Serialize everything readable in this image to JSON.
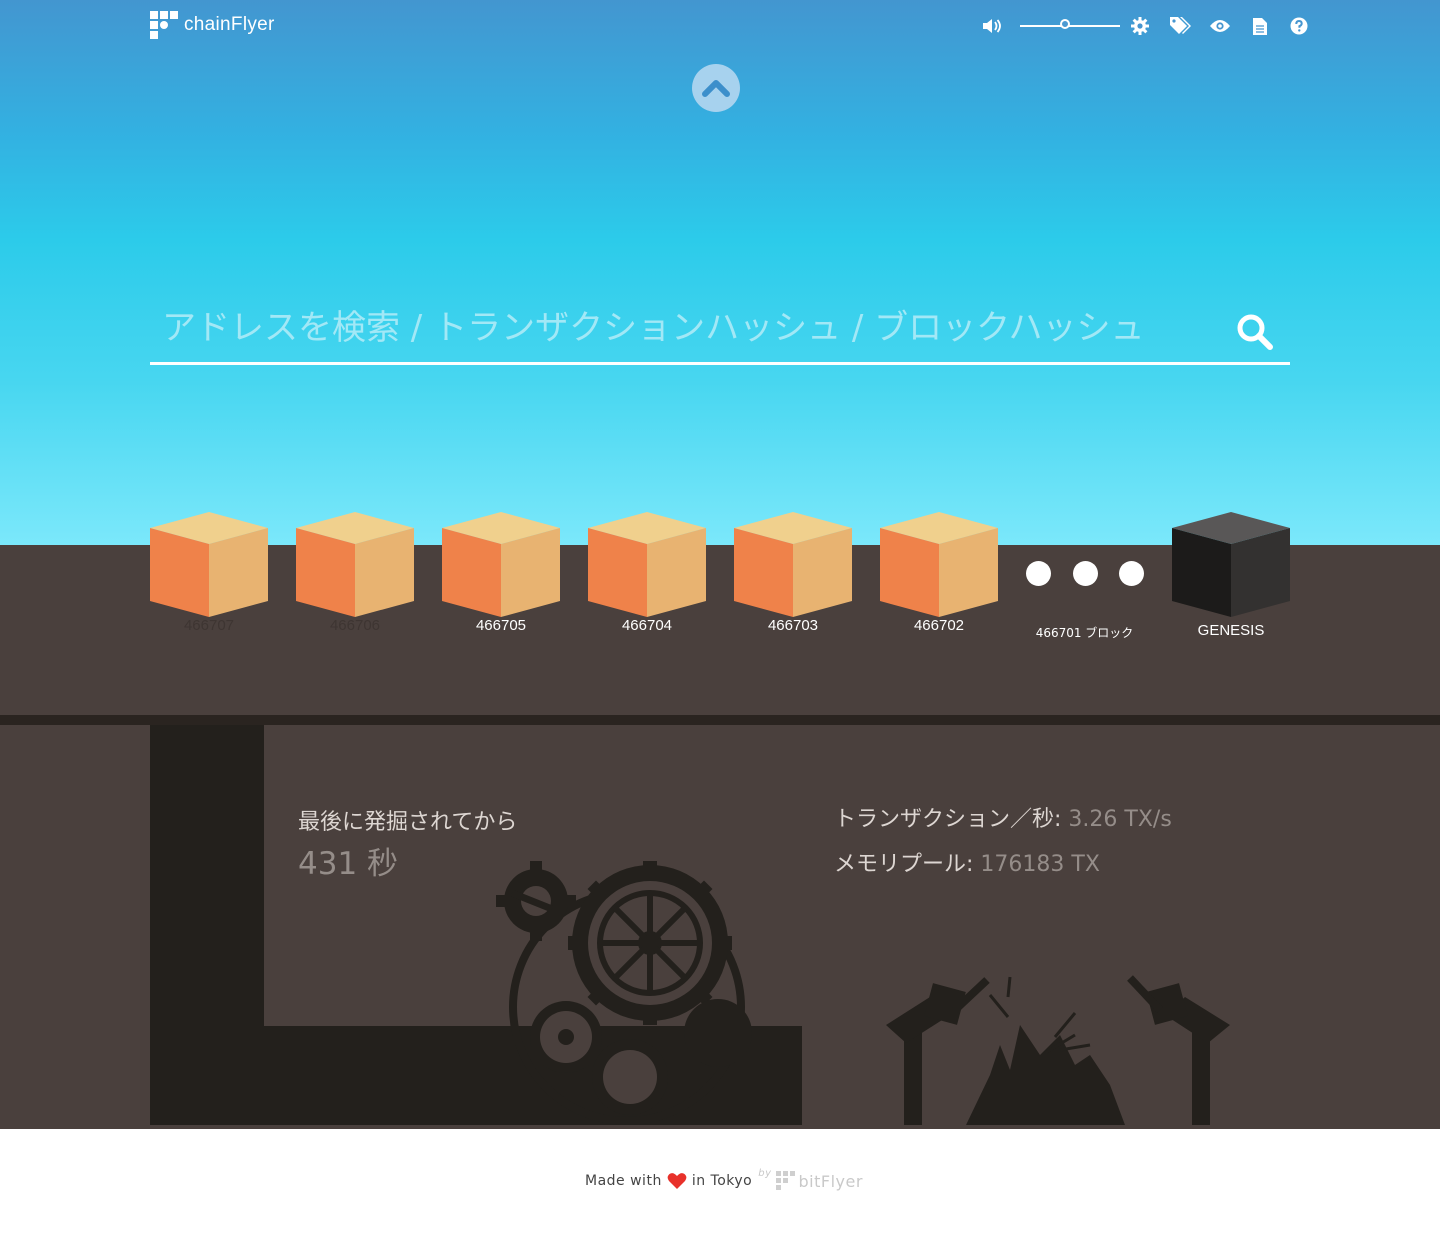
{
  "app": {
    "brand": "chainFlyer"
  },
  "toolbar": {
    "volume_level": 0.45,
    "icons": [
      "volume-icon",
      "settings-icon",
      "tags-icon",
      "eye-icon",
      "document-icon",
      "help-icon"
    ]
  },
  "search": {
    "placeholder": "アドレスを検索 / トランザクションハッシュ / ブロックハッシュ"
  },
  "blocks": [
    {
      "label": "466707",
      "faded": true
    },
    {
      "label": "466706",
      "faded": true
    },
    {
      "label": "466705"
    },
    {
      "label": "466704"
    },
    {
      "label": "466703"
    },
    {
      "label": "466702"
    }
  ],
  "remaining": {
    "label": "466701 ブロック"
  },
  "genesis": {
    "label": "GENESIS"
  },
  "mining": {
    "since_label": "最後に発掘されてから",
    "since_value": "431 秒",
    "tx_rate_label": "トランザクション／秒",
    "tx_rate_value": "3.26 TX/s",
    "mempool_label": "メモリプール",
    "mempool_value": "176183 TX",
    "colon": ": "
  },
  "footer": {
    "made_with": "Made with",
    "in_tokyo": "in Tokyo",
    "by": "by",
    "company": "bitFlyer"
  },
  "colors": {
    "sky_top": "#4396d0",
    "sky_bottom": "#7be8fb",
    "ground": "#4a403d",
    "block_orange": "#ef824a",
    "block_tan": "#e8b371",
    "block_top": "#f0d08d",
    "heart": "#e8312a"
  }
}
